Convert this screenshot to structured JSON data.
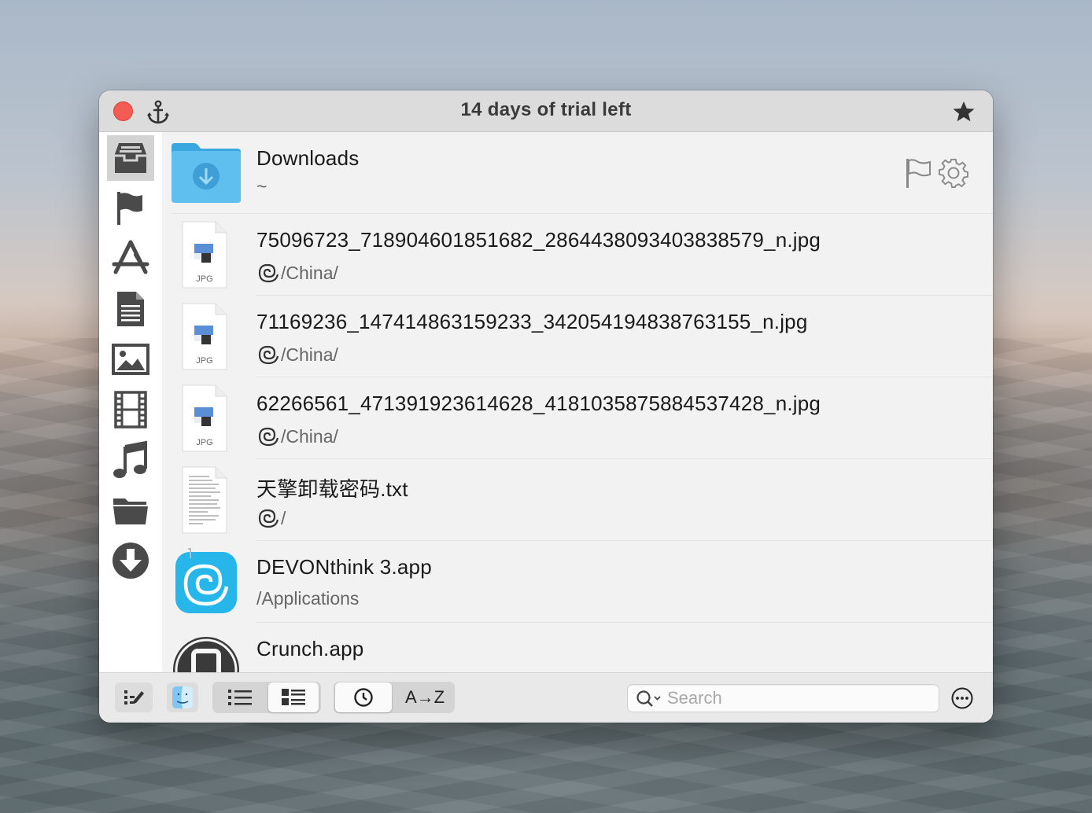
{
  "window": {
    "title": "14 days of trial left"
  },
  "sidebar": {
    "items": [
      {
        "icon": "inbox-tray-icon",
        "active": true
      },
      {
        "icon": "flag-icon"
      },
      {
        "icon": "app-store-icon"
      },
      {
        "icon": "document-icon"
      },
      {
        "icon": "image-icon"
      },
      {
        "icon": "film-icon"
      },
      {
        "icon": "music-note-icon"
      },
      {
        "icon": "folder-icon"
      },
      {
        "icon": "download-arrow-icon"
      }
    ]
  },
  "header_row": {
    "name": "Downloads",
    "path": "~",
    "icon": "downloads-folder-icon"
  },
  "files": [
    {
      "name": "75096723_718904601851682_2864438093403838579_n.jpg",
      "path": "/China/",
      "icon": "jpg-file-icon",
      "type_label": "JPG"
    },
    {
      "name": "71169236_147414863159233_342054194838763155_n.jpg",
      "path": "/China/",
      "icon": "jpg-file-icon",
      "type_label": "JPG"
    },
    {
      "name": "62266561_471391923614628_4181035875884537428_n.jpg",
      "path": "/China/",
      "icon": "jpg-file-icon",
      "type_label": "JPG"
    },
    {
      "name": "天擎卸载密码.txt",
      "path": "/",
      "icon": "text-file-icon"
    },
    {
      "name": "DEVONthink 3.app",
      "path": "/Applications",
      "icon": "devonthink-app-icon"
    },
    {
      "name": "Crunch.app",
      "path": "",
      "icon": "crunch-app-icon"
    }
  ],
  "toolbar": {
    "sort_label": "A→Z",
    "search_placeholder": "Search",
    "search_value": ""
  },
  "colors": {
    "close": "#f45b53",
    "folder_blue": "#5fbfee",
    "devon_blue": "#27b6ea"
  }
}
